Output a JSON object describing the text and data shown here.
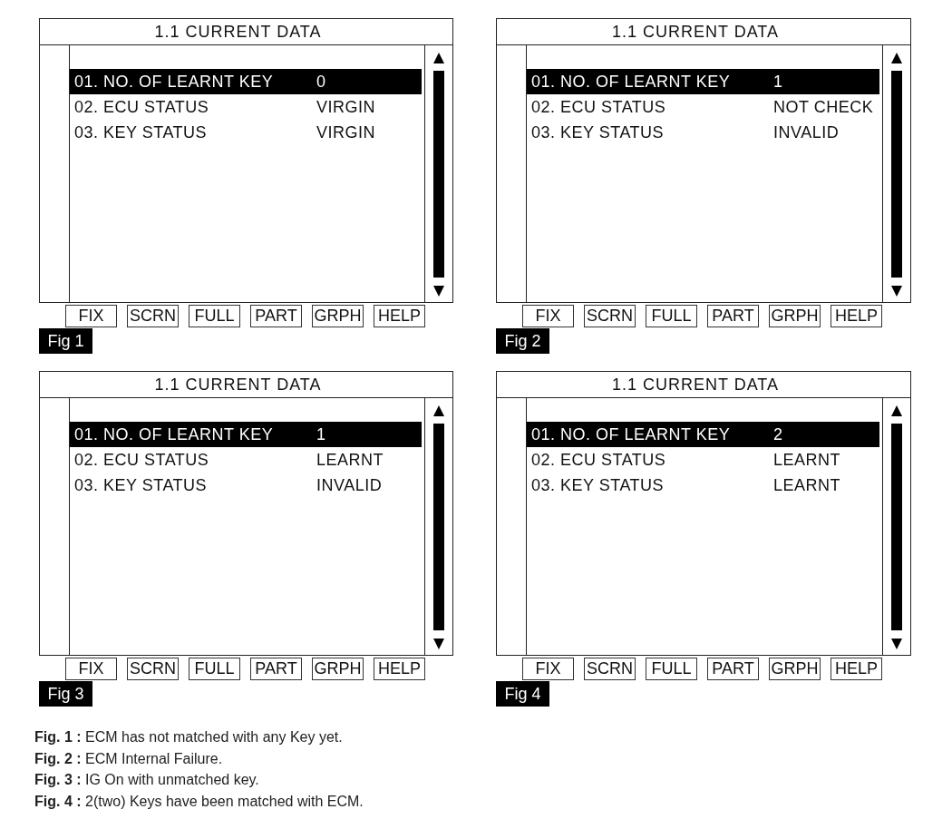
{
  "figures": [
    {
      "title": "1.1 CURRENT DATA",
      "rows": [
        {
          "label": "01. NO. OF LEARNT KEY",
          "value": "0",
          "selected": true
        },
        {
          "label": "02. ECU STATUS",
          "value": "VIRGIN",
          "selected": false
        },
        {
          "label": "03. KEY STATUS",
          "value": "VIRGIN",
          "selected": false
        }
      ],
      "buttons": [
        "FIX",
        "SCRN",
        "FULL",
        "PART",
        "GRPH",
        "HELP"
      ],
      "figure_label": "Fig 1"
    },
    {
      "title": "1.1 CURRENT DATA",
      "rows": [
        {
          "label": "01. NO. OF LEARNT KEY",
          "value": "1",
          "selected": true
        },
        {
          "label": "02. ECU STATUS",
          "value": "NOT CHECK",
          "selected": false
        },
        {
          "label": "03. KEY STATUS",
          "value": "INVALID",
          "selected": false
        }
      ],
      "buttons": [
        "FIX",
        "SCRN",
        "FULL",
        "PART",
        "GRPH",
        "HELP"
      ],
      "figure_label": "Fig 2"
    },
    {
      "title": "1.1 CURRENT DATA",
      "rows": [
        {
          "label": "01. NO. OF LEARNT KEY",
          "value": "1",
          "selected": true
        },
        {
          "label": "02. ECU STATUS",
          "value": "LEARNT",
          "selected": false
        },
        {
          "label": "03. KEY STATUS",
          "value": "INVALID",
          "selected": false
        }
      ],
      "buttons": [
        "FIX",
        "SCRN",
        "FULL",
        "PART",
        "GRPH",
        "HELP"
      ],
      "figure_label": "Fig 3"
    },
    {
      "title": "1.1 CURRENT DATA",
      "rows": [
        {
          "label": "01. NO. OF LEARNT KEY",
          "value": "2",
          "selected": true
        },
        {
          "label": "02. ECU STATUS",
          "value": "LEARNT",
          "selected": false
        },
        {
          "label": "03. KEY STATUS",
          "value": "LEARNT",
          "selected": false
        }
      ],
      "buttons": [
        "FIX",
        "SCRN",
        "FULL",
        "PART",
        "GRPH",
        "HELP"
      ],
      "figure_label": "Fig 4"
    }
  ],
  "captions": [
    "**Fig. 1 :** ECM has not matched with any Key yet.",
    "**Fig. 2 :** ECM Internal Failure.",
    "**Fig. 3 :** IG On with unmatched key.",
    "**Fig. 4 :** 2(two) Keys have been matched with ECM."
  ]
}
